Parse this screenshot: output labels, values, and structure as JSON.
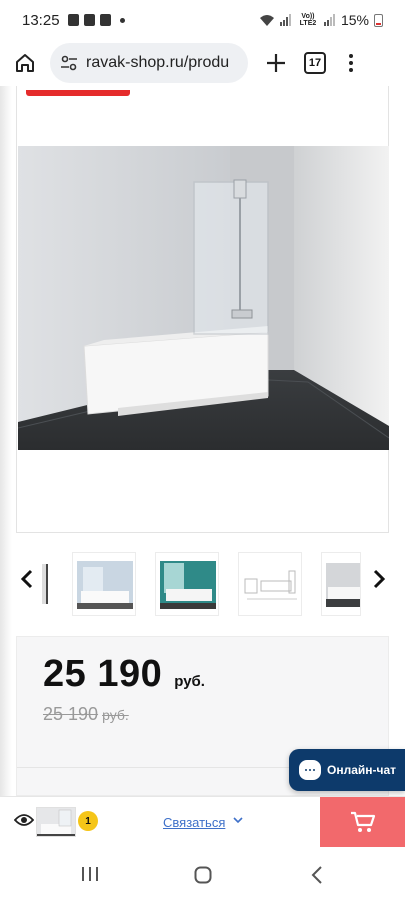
{
  "status_bar": {
    "time": "13:25",
    "network_label": "Vo)) LTE2",
    "battery": "15%"
  },
  "browser": {
    "url": "ravak-shop.ru/produ",
    "tab_count": "17"
  },
  "product": {
    "price": "25 190",
    "currency": "руб.",
    "old_price": "25 190",
    "old_currency": "руб."
  },
  "chat": {
    "label": "Онлайн-чат"
  },
  "bottom_bar": {
    "viewed_count": "1",
    "contact_label": "Связаться"
  },
  "colors": {
    "accent_red": "#e52b2b",
    "cart_button": "#f2696c",
    "chat_button": "#0d3a6b",
    "link_blue": "#3e70c9",
    "badge_yellow": "#f5c518"
  },
  "icons": {
    "home": "home-icon",
    "site_settings": "tune-icon",
    "new_tab": "plus-icon",
    "tabs": "tabs-icon",
    "menu": "more-vert-icon",
    "carousel_prev": "chevron-left-icon",
    "carousel_next": "chevron-right-icon",
    "viewed": "eye-icon",
    "cart": "cart-icon",
    "chat": "chat-bubble-icon"
  }
}
